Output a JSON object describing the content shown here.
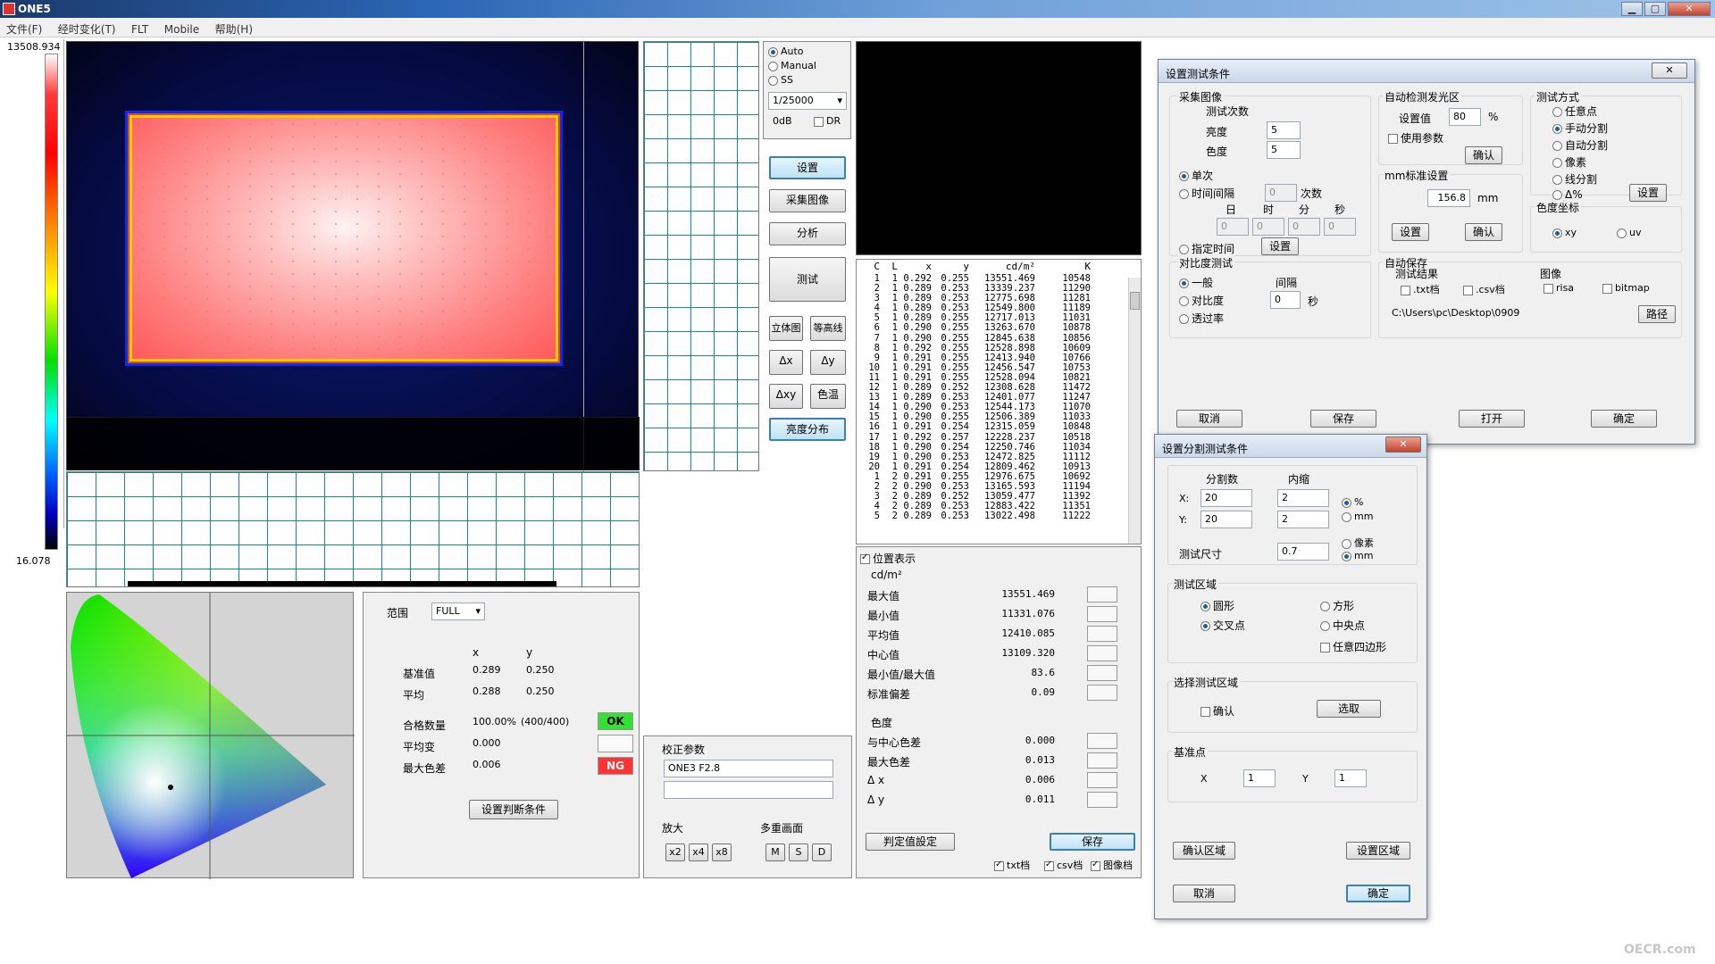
{
  "window": {
    "title": "ONE5",
    "minimize": "▁",
    "maximize": "▢",
    "close": "✕"
  },
  "menu": [
    "文件(F)",
    "经时变化(T)",
    "FLT",
    "Mobile",
    "帮助(H)"
  ],
  "scale": {
    "max": "13508.934",
    "min": "16.078"
  },
  "camera": {
    "modes": [
      "Auto",
      "Manual",
      "SS"
    ],
    "mode_selected": "Auto",
    "shutter": "1/25000",
    "gain": "0dB",
    "dr_label": "DR"
  },
  "buttons": {
    "setup": "设置",
    "capture": "采集图像",
    "analyze": "分析",
    "measure": "测试",
    "view3d": "立体图",
    "contour": "等高线",
    "dx": "Δx",
    "dy": "Δy",
    "dxy": "Δxy",
    "ct": "色温",
    "lum_dist": "亮度分布"
  },
  "table": {
    "headers": [
      "C",
      "L",
      "x",
      "y",
      "cd/m²",
      "K"
    ],
    "rows": [
      [
        "1",
        "1",
        "0.292",
        "0.255",
        "13551.469",
        "10548"
      ],
      [
        "2",
        "1",
        "0.289",
        "0.253",
        "13339.237",
        "11290"
      ],
      [
        "3",
        "1",
        "0.289",
        "0.253",
        "12775.698",
        "11281"
      ],
      [
        "4",
        "1",
        "0.289",
        "0.253",
        "12549.800",
        "11189"
      ],
      [
        "5",
        "1",
        "0.289",
        "0.255",
        "12717.013",
        "11031"
      ],
      [
        "6",
        "1",
        "0.290",
        "0.255",
        "13263.670",
        "10878"
      ],
      [
        "7",
        "1",
        "0.290",
        "0.255",
        "12845.638",
        "10856"
      ],
      [
        "8",
        "1",
        "0.292",
        "0.255",
        "12528.898",
        "10609"
      ],
      [
        "9",
        "1",
        "0.291",
        "0.255",
        "12413.940",
        "10766"
      ],
      [
        "10",
        "1",
        "0.291",
        "0.255",
        "12456.547",
        "10753"
      ],
      [
        "11",
        "1",
        "0.291",
        "0.255",
        "12528.094",
        "10821"
      ],
      [
        "12",
        "1",
        "0.289",
        "0.252",
        "12308.628",
        "11472"
      ],
      [
        "13",
        "1",
        "0.289",
        "0.253",
        "12401.077",
        "11247"
      ],
      [
        "14",
        "1",
        "0.290",
        "0.253",
        "12544.173",
        "11070"
      ],
      [
        "15",
        "1",
        "0.290",
        "0.255",
        "12506.389",
        "11033"
      ],
      [
        "16",
        "1",
        "0.291",
        "0.254",
        "12315.059",
        "10848"
      ],
      [
        "17",
        "1",
        "0.292",
        "0.257",
        "12228.237",
        "10518"
      ],
      [
        "18",
        "1",
        "0.290",
        "0.254",
        "12250.746",
        "11034"
      ],
      [
        "19",
        "1",
        "0.290",
        "0.253",
        "12472.825",
        "11112"
      ],
      [
        "20",
        "1",
        "0.291",
        "0.254",
        "12809.462",
        "10913"
      ],
      [
        "1",
        "2",
        "0.291",
        "0.255",
        "12976.675",
        "10692"
      ],
      [
        "2",
        "2",
        "0.290",
        "0.253",
        "13165.593",
        "11194"
      ],
      [
        "3",
        "2",
        "0.289",
        "0.252",
        "13059.477",
        "11392"
      ],
      [
        "4",
        "2",
        "0.289",
        "0.253",
        "12883.422",
        "11351"
      ],
      [
        "5",
        "2",
        "0.289",
        "0.253",
        "13022.498",
        "11222"
      ]
    ]
  },
  "stats": {
    "position_display": "位置表示",
    "unit": "cd/m²",
    "rows": [
      {
        "k": "最大值",
        "v": "13551.469"
      },
      {
        "k": "最小值",
        "v": "11331.076"
      },
      {
        "k": "平均值",
        "v": "12410.085"
      },
      {
        "k": "中心值",
        "v": "13109.320"
      },
      {
        "k": "最小值/最大值",
        "v": "83.6"
      },
      {
        "k": "标准偏差",
        "v": "0.09"
      }
    ],
    "chroma_title": "色度",
    "chroma_rows": [
      {
        "k": "与中心色差",
        "v": "0.000"
      },
      {
        "k": "最大色差",
        "v": "0.013"
      },
      {
        "k": "Δ x",
        "v": "0.006"
      },
      {
        "k": "Δ y",
        "v": "0.011"
      }
    ],
    "judge_btn": "判定值設定",
    "save_btn": "保存",
    "txt": "txt档",
    "csv": "csv档",
    "img": "图像档"
  },
  "range": {
    "label": "范围",
    "value": "FULL",
    "x": "x",
    "y": "y",
    "ref_label": "基准值",
    "ref_x": "0.289",
    "ref_y": "0.250",
    "avg_label": "平均",
    "avg_x": "0.288",
    "avg_y": "0.250",
    "pass_label": "合格数量",
    "pass_pct": "100.00%",
    "pass_count": "(400/400)",
    "ok": "OK",
    "avgvar_label": "平均变",
    "avgvar": "0.000",
    "maxdiff_label": "最大色差",
    "maxdiff": "0.006",
    "ng": "NG",
    "judge_btn": "设置判断条件"
  },
  "calib": {
    "title": "校正参数",
    "value": "ONE3 F2.8",
    "zoom_title": "放大",
    "zoom": [
      "x2",
      "x4",
      "x8"
    ],
    "multi_title": "多重画面",
    "multi": [
      "M",
      "S",
      "D"
    ]
  },
  "dlg1": {
    "title": "设置测试条件",
    "capture_title": "采集图像",
    "count_title": "测试次数",
    "lum_label": "亮度",
    "lum": "5",
    "chroma_label": "色度",
    "chroma": "5",
    "single": "单次",
    "interval": "时间间隔",
    "interval_val": "0",
    "times": "次数",
    "d": "日",
    "h": "时",
    "m": "分",
    "s": "秒",
    "zero": "0",
    "specify": "指定时间",
    "specify_btn": "设置",
    "auto_title": "自动检测发光区",
    "set_label": "设置值",
    "set_val": "80",
    "pct": "%",
    "use_param": "使用参数",
    "confirm": "确认",
    "mm_title": "mm标准设置",
    "mm_val": "156.8",
    "mm": "mm",
    "mm_set": "设置",
    "method_title": "测试方式",
    "methods": [
      "任意点",
      "手动分割",
      "自动分割",
      "像素",
      "线分割",
      "Δ%"
    ],
    "method_selected": "手动分割",
    "method_set": "设置",
    "coord_title": "色度坐标",
    "xy": "xy",
    "uv": "uv",
    "contrast_title": "对比度测试",
    "general": "一般",
    "contrast": "对比度",
    "transmit": "透过率",
    "gap": "间隔",
    "gap_val": "0",
    "sec": "秒",
    "autosave_title": "自动保存",
    "result_title": "测试结果",
    "txt": ".txt档",
    "csv": ".csv档",
    "image_title": "图像",
    "risa": "risa",
    "bitmap": "bitmap",
    "path": "C:\\Users\\pc\\Desktop\\0909",
    "path_btn": "路径",
    "cancel": "取消",
    "save": "保存",
    "open": "打开",
    "ok": "确定"
  },
  "dlg2": {
    "title": "设置分割测试条件",
    "div_title": "分割数",
    "inner_title": "内缩",
    "x_label": "X:",
    "x_div": "20",
    "x_inner": "2",
    "y_label": "Y:",
    "y_div": "20",
    "y_inner": "2",
    "pct": "%",
    "mm": "mm",
    "size_label": "测试尺寸",
    "size_val": "0.7",
    "pixel": "像素",
    "mm2": "mm",
    "area_title": "测试区域",
    "circle": "圆形",
    "square": "方形",
    "cross": "交叉点",
    "center": "中央点",
    "quad": "任意四边形",
    "sel_title": "选择测试区域",
    "sel_confirm": "确认",
    "sel_btn": "选取",
    "ref_title": "基准点",
    "ref_x_label": "X",
    "ref_x": "1",
    "ref_y_label": "Y",
    "ref_y": "1",
    "confirm_area": "确认区域",
    "set_area": "设置区域",
    "cancel": "取消",
    "ok": "确定"
  },
  "watermark": "OECR.com"
}
